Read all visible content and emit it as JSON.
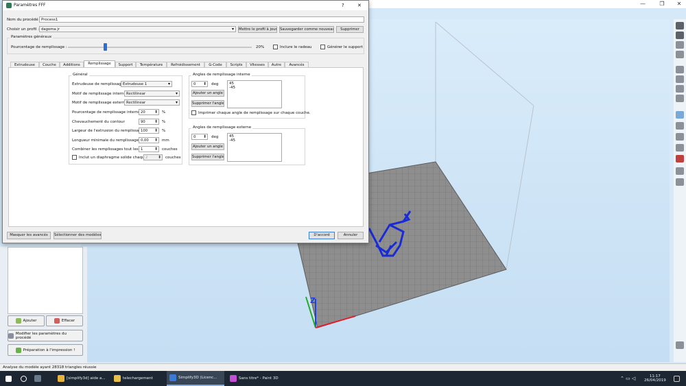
{
  "app": {
    "window_controls": [
      "—",
      "❐",
      "✕"
    ],
    "status_text": "Analyse du modèle ayant 28318 triangles réussie",
    "left_buttons": {
      "add": "Ajouter",
      "delete": "Effacer",
      "modify_process": "Modifier les paramètres du procédé",
      "prepare_print": "Préparation à l'impression !"
    }
  },
  "dialog": {
    "title": "Paramètres FFF",
    "help": "?",
    "close": "✕",
    "process_name_label": "Nom du procédé :",
    "process_name_value": "Process1",
    "profile_label": "Choisir un profil :",
    "profile_value": "dagoma jr",
    "update_profile": "Mettre le profil à jour",
    "save_as_new": "Sauvegarder comme nouveau",
    "delete": "Supprimer",
    "general_settings_title": "Paramètres généraux",
    "infill_percentage_label": "Pourcentage de remplissage :",
    "infill_percentage_value": "20%",
    "slider_fraction": 0.2,
    "include_raft": "Inclure le radeau",
    "generate_support": "Générer le support",
    "tabs": [
      "Extrudeuse",
      "Couche",
      "Additions",
      "Remplissage",
      "Support",
      "Température",
      "Refroidissement",
      "G-Code",
      "Scripts",
      "Vitesses",
      "Autre",
      "Avancés"
    ],
    "active_tab": "Remplissage",
    "general": {
      "title": "Général",
      "extruder_label": "Extrudeuse de remplissage",
      "extruder_value": "Extrudeuse 1",
      "internal_pattern_label": "Motif de remplissage interne",
      "internal_pattern_value": "Rectilinear",
      "external_pattern_label": "Motif de remplissage externe",
      "external_pattern_value": "Rectilinear",
      "internal_pct_label": "Pourcentage de remplissage interne",
      "internal_pct_value": "20",
      "internal_pct_unit": "%",
      "outline_overlap_label": "Chevauchement du contour",
      "outline_overlap_value": "90",
      "outline_overlap_unit": "%",
      "extrusion_width_label": "Largeur de l'extrusion du remplissage",
      "extrusion_width_value": "100",
      "extrusion_width_unit": "%",
      "min_length_label": "Longueur minimale du remplissage",
      "min_length_value": "0,00",
      "min_length_unit": "mm",
      "combine_label": "Combiner les remplissages tout les",
      "combine_value": "1",
      "combine_unit": "couches",
      "diaphragm_label": "Inclut un diaphragme solide chaque",
      "diaphragm_value": "2",
      "diaphragm_unit": "couches"
    },
    "internal_angles": {
      "title": "Angles de remplissage interne",
      "input_value": "0",
      "unit": "deg",
      "add": "Ajouter un angle",
      "remove": "Supprimer l'angle",
      "angles": [
        "45",
        "-45"
      ],
      "print_each_label": "Imprimer chaque angle de remplissage sur chaque couche."
    },
    "external_angles": {
      "title": "Angles de remplissage externe",
      "input_value": "0",
      "unit": "deg",
      "add": "Ajouter un angle",
      "remove": "Supprimer l'angle",
      "angles": [
        "45",
        "-45"
      ]
    },
    "hide_advanced": "Masquer les avancés",
    "select_models": "Sélectionner des modèles",
    "ok": "D'accord",
    "cancel": "Annuler"
  },
  "viewport": {
    "axis_label": "Z",
    "colors": {
      "bed": "#8f8f8f",
      "model": "#1a2bd6",
      "x_axis": "#e0202a",
      "y_axis": "#22aa22",
      "z_axis": "#2040e0"
    }
  },
  "taskbar": {
    "items": [
      "[simplify3d] aide a...",
      "telechargement",
      "Simplify3D (Licenc...",
      "Sans titre* - Paint 3D"
    ],
    "time": "11:17",
    "date": "26/04/2019"
  }
}
